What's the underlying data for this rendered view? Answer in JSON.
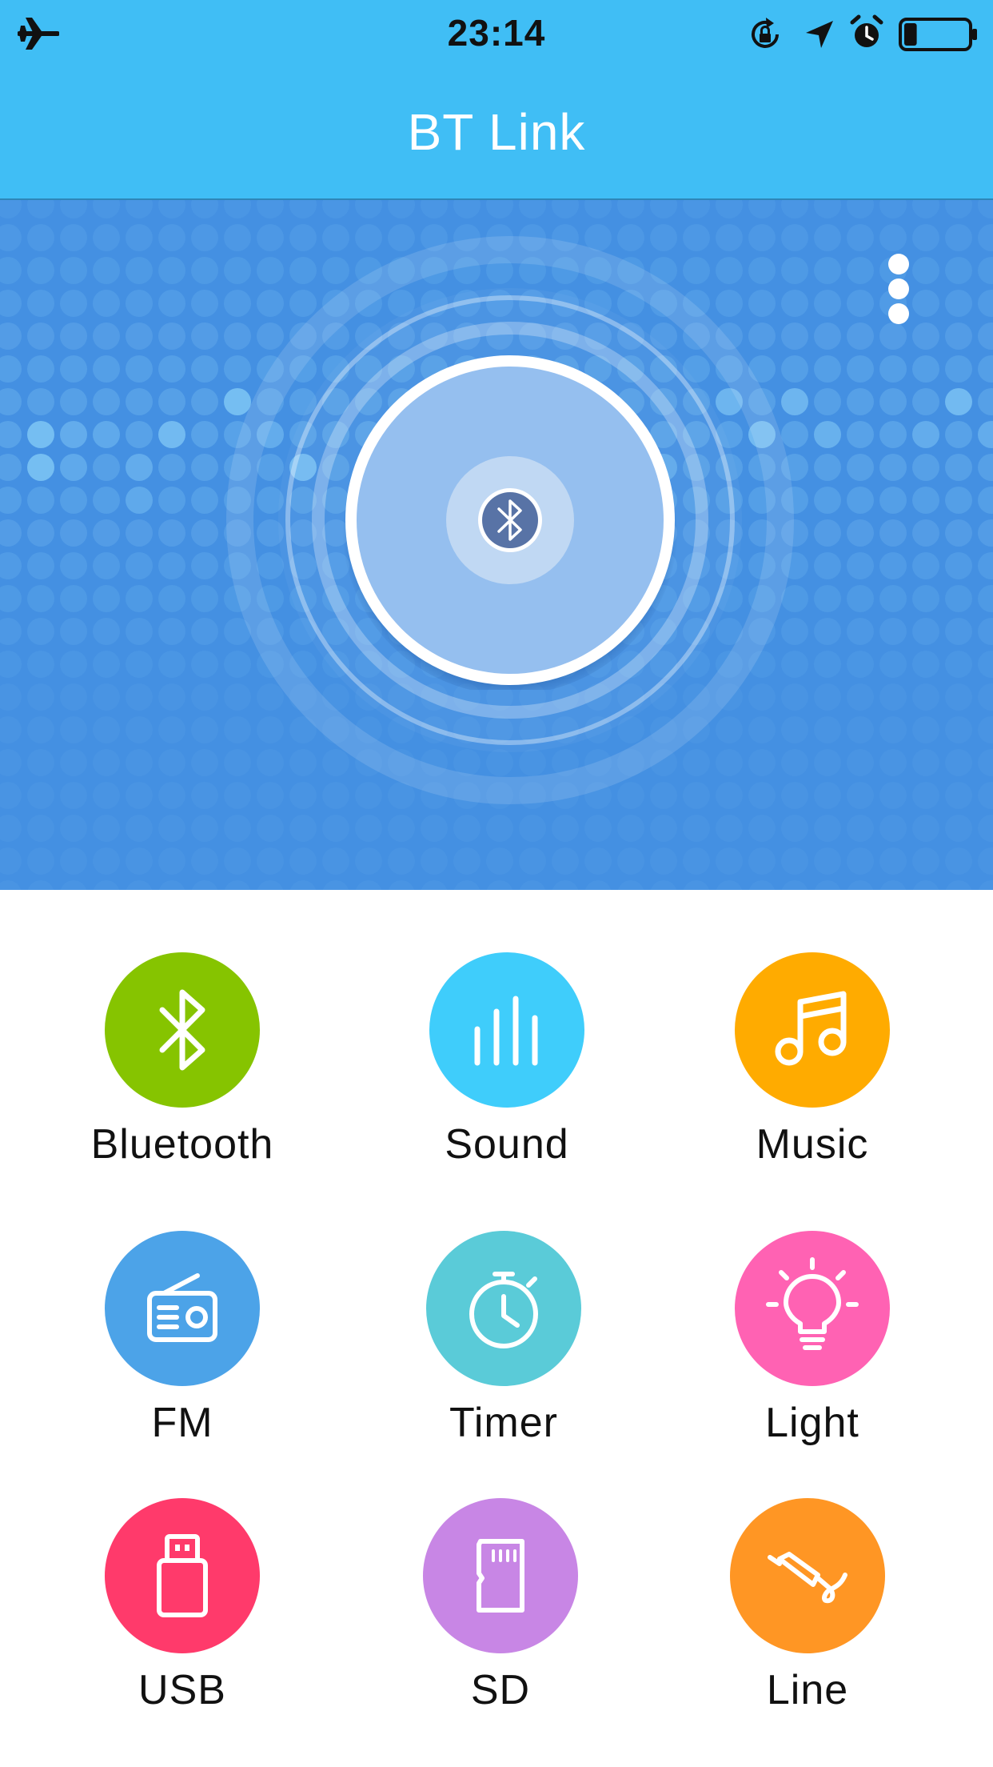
{
  "status_bar": {
    "time": "23:14",
    "icons": [
      "airplane-mode-icon",
      "rotation-lock-icon",
      "location-icon",
      "alarm-icon",
      "battery-icon"
    ],
    "battery_level": 0.2
  },
  "header": {
    "title": "BT Link",
    "background_color": "#40BEF5"
  },
  "hero": {
    "background_color": "#4490E2",
    "menu_icon": "more-vertical-icon",
    "center_icon": "bluetooth-icon"
  },
  "functions": [
    {
      "id": "bluetooth",
      "label": "Bluetooth",
      "color": "#86C400",
      "icon": "bluetooth-icon"
    },
    {
      "id": "sound",
      "label": "Sound",
      "color": "#3FCDFB",
      "icon": "equalizer-icon"
    },
    {
      "id": "music",
      "label": "Music",
      "color": "#FFAB00",
      "icon": "music-note-icon"
    },
    {
      "id": "fm",
      "label": "FM",
      "color": "#4CA3E8",
      "icon": "radio-icon"
    },
    {
      "id": "timer",
      "label": "Timer",
      "color": "#5ACBD8",
      "icon": "stopwatch-icon"
    },
    {
      "id": "light",
      "label": "Light",
      "color": "#FF62B3",
      "icon": "light-bulb-icon"
    },
    {
      "id": "usb",
      "label": "USB",
      "color": "#FF3A6B",
      "icon": "usb-drive-icon"
    },
    {
      "id": "sd",
      "label": "SD",
      "color": "#C886E5",
      "icon": "sd-card-icon"
    },
    {
      "id": "line",
      "label": "Line",
      "color": "#FF9624",
      "icon": "audio-jack-icon"
    }
  ]
}
